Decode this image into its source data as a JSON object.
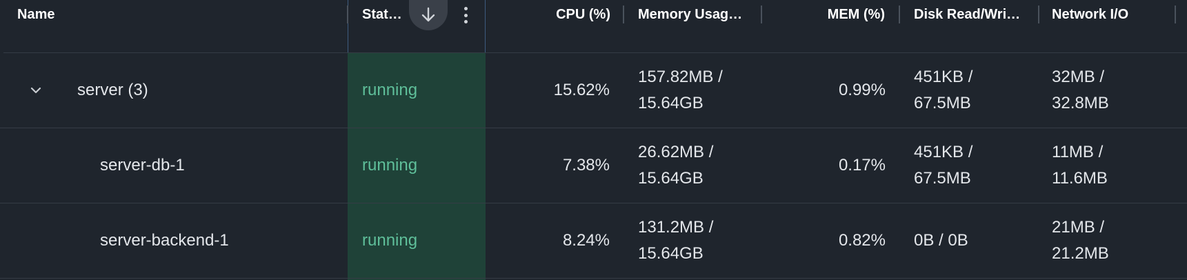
{
  "columns": {
    "name": "Name",
    "status": "Stat…",
    "cpu": "CPU (%)",
    "memory_usage": "Memory Usag…",
    "mem_pct": "MEM (%)",
    "disk": "Disk Read/Wri…",
    "network": "Network I/O"
  },
  "header_icons": {
    "sort": "arrow-down-icon",
    "menu": "kebab-menu-icon"
  },
  "colors": {
    "background": "#1f252d",
    "status_highlight": "#1f4238",
    "status_text": "#5fbf9a",
    "sort_button": "#3a4049"
  },
  "rows": [
    {
      "name": "server (3)",
      "status": "running",
      "cpu": "15.62%",
      "memory_usage_line1": "157.82MB /",
      "memory_usage_line2": "15.64GB",
      "mem_pct": "0.99%",
      "disk_line1": "451KB /",
      "disk_line2": "67.5MB",
      "network_line1": "32MB /",
      "network_line2": "32.8MB"
    },
    {
      "name": "server-db-1",
      "status": "running",
      "cpu": "7.38%",
      "memory_usage_line1": "26.62MB /",
      "memory_usage_line2": "15.64GB",
      "mem_pct": "0.17%",
      "disk_line1": "451KB /",
      "disk_line2": "67.5MB",
      "network_line1": "11MB /",
      "network_line2": "11.6MB"
    },
    {
      "name": "server-backend-1",
      "status": "running",
      "cpu": "8.24%",
      "memory_usage_line1": "131.2MB /",
      "memory_usage_line2": "15.64GB",
      "mem_pct": "0.82%",
      "disk_line1": "0B / 0B",
      "disk_line2": "",
      "network_line1": "21MB /",
      "network_line2": "21.2MB"
    }
  ]
}
